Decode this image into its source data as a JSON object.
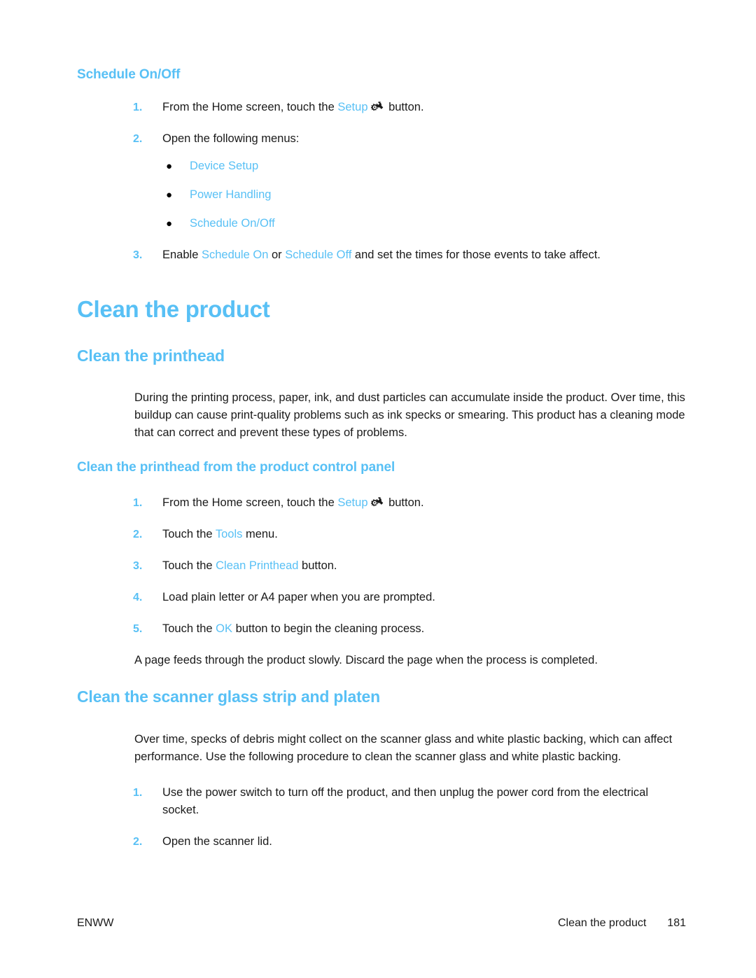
{
  "document": {
    "page_number": "181",
    "footer_left": "ENWW",
    "footer_chapter": "Clean the product"
  },
  "schedule_section": {
    "heading": "Schedule On/Off",
    "steps": [
      {
        "number": "1.",
        "text_before": "From the Home screen, touch the ",
        "ui_term": "Setup",
        "icon": "setup-wrench-gear-icon",
        "text_after": " button."
      },
      {
        "number": "2.",
        "text_before": "Open the following menus:",
        "ui_term": "",
        "text_after": ""
      },
      {
        "number": "3.",
        "text_before": "Enable ",
        "ui_term": "Schedule On",
        "text_middle": " or ",
        "ui_term_2": "Schedule Off",
        "text_after": " and set the times for those events to take affect."
      }
    ],
    "menu_path": [
      {
        "bullet": "●",
        "label": "Device Setup"
      },
      {
        "bullet": "●",
        "label": "Power Handling"
      },
      {
        "bullet": "●",
        "label": "Schedule On/Off"
      }
    ]
  },
  "clean_product": {
    "chapter_heading": "Clean the product",
    "printhead": {
      "heading": "Clean the printhead",
      "body": "During the printing process, paper, ink, and dust particles can accumulate inside the product. Over time, this buildup can cause print-quality problems such as ink specks or smearing. This product has a cleaning mode that can correct and prevent these types of problems.",
      "control_panel": {
        "heading": "Clean the printhead from the product control panel",
        "steps": [
          {
            "number": "1.",
            "text_before": "From the Home screen, touch the ",
            "ui_term": "Setup",
            "icon": "setup-wrench-gear-icon",
            "text_after": " button."
          },
          {
            "number": "2.",
            "text_before": "Touch the ",
            "ui_term": "Tools",
            "text_after": " menu."
          },
          {
            "number": "3.",
            "text_before": "Touch the ",
            "ui_term": "Clean Printhead",
            "text_after": " button."
          },
          {
            "number": "4.",
            "text_before": "Load plain letter or A4 paper when you are prompted.",
            "ui_term": "",
            "text_after": ""
          },
          {
            "number": "5.",
            "text_before": "Touch the ",
            "ui_term": "OK",
            "text_after": " button to begin the cleaning process."
          }
        ],
        "closing_note": "A page feeds through the product slowly. Discard the page when the process is completed."
      }
    },
    "scanner": {
      "heading": "Clean the scanner glass strip and platen",
      "body": "Over time, specks of debris might collect on the scanner glass and white plastic backing, which can affect performance. Use the following procedure to clean the scanner glass and white plastic backing.",
      "steps": [
        {
          "number": "1.",
          "text_before": "Use the power switch to turn off the product, and then unplug the power cord from the electrical socket.",
          "ui_term": "",
          "text_after": ""
        },
        {
          "number": "2.",
          "text_before": "Open the scanner lid.",
          "ui_term": "",
          "text_after": ""
        }
      ]
    }
  },
  "colors": {
    "accent_blue": "#58C0F5",
    "body_text": "#1a1a1a",
    "page_background": "#ffffff"
  }
}
